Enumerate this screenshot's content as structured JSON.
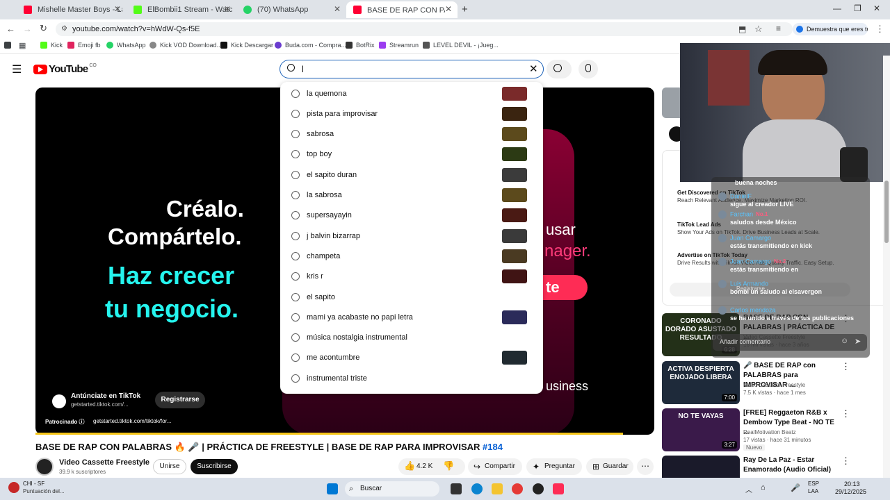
{
  "tabs": [
    {
      "title": "Mishelle Master Boys - La Quem",
      "fav": "#ff0033"
    },
    {
      "title": "ElBombii1 Stream - Watch Live",
      "fav": "#53fc18"
    },
    {
      "title": "(70) WhatsApp",
      "fav": "#25d366"
    },
    {
      "title": "BASE DE RAP CON PALABRAS 🔥",
      "fav": "#ff0033"
    }
  ],
  "address": {
    "url": "youtube.com/watch?v=hWdW-Qs-f5E",
    "profile_text": "Demuestra que eres tú"
  },
  "bookmarks": [
    "Kick",
    "Emoji fb",
    "WhatsApp",
    "Kick VOD Download...",
    "Kick Descargar",
    "Buda.com - Compra...",
    "BotRix",
    "Streamrun",
    "LEVEL DEVIL - ¡Jueg..."
  ],
  "yt": {
    "logo": "YouTube",
    "logo_suffix": "CO",
    "search_value": "l"
  },
  "suggestions": [
    {
      "text": "la quemona",
      "thumb": "#7a2a2a"
    },
    {
      "text": "pista para improvisar",
      "thumb": "#3a2410"
    },
    {
      "text": "sabrosa",
      "thumb": "#5c4a1c"
    },
    {
      "text": "top boy",
      "thumb": "#2c3a14"
    },
    {
      "text": "el sapito duran",
      "thumb": "#3b3b3b"
    },
    {
      "text": "la sabrosa",
      "thumb": "#5c4a1c"
    },
    {
      "text": "supersayayin",
      "thumb": "#4a1a14"
    },
    {
      "text": "j balvin bizarrap",
      "thumb": "#3a3a3a"
    },
    {
      "text": "champeta",
      "thumb": "#4a3a22"
    },
    {
      "text": "kris r",
      "thumb": "#401414"
    },
    {
      "text": "el sapito",
      "thumb": null
    },
    {
      "text": "mami ya acabaste no papi letra",
      "thumb": "#2b2b5a"
    },
    {
      "text": "música nostalgia instrumental",
      "thumb": null
    },
    {
      "text": "me acontumbre",
      "thumb": "#202a30"
    },
    {
      "text": "instrumental triste",
      "thumb": null
    }
  ],
  "ad": {
    "line1": "Créalo.",
    "line2": "Compártelo.",
    "line3": "Haz crecer",
    "line4": "tu negocio.",
    "right_line1": "usar",
    "right_line2": "nager.",
    "right_badge": "te",
    "right_footer": "usiness",
    "advertiser": "Antúnciate en TikTok",
    "advertiser_url": "getstarted.tiktok.com/...",
    "register": "Registrarse",
    "sponsored": "Patrocinado",
    "sponsored_url": "getstarted.tiktok.com/tiktok/for..."
  },
  "video": {
    "title": "BASE DE RAP CON PALABRAS 🔥 🎤 | PRÁCTICA DE FREESTYLE | BASE DE RAP PARA IMPROVISAR",
    "hashtag": "#184",
    "channel": "Video Cassette Freestyle",
    "subs": "39.9 k suscriptores",
    "join": "Unirse",
    "subscribe": "Suscribirse",
    "likes": "4.2 K",
    "share": "Compartir",
    "ask": "Preguntar",
    "save": "Guardar"
  },
  "sidebar_ads": [
    {
      "title": "Get Discovered on TikTok",
      "sub": "Reach Relevant Audience. Maximize Marketing ROI."
    },
    {
      "title": "TikTok Lead Ads",
      "sub": "Show Your Ads on TikTok. Drive Business Leads at Scale."
    },
    {
      "title": "Advertise on TikTok Today",
      "sub": "Drive Results with TikTok Video Ads Quality Traffic. Easy Setup."
    }
  ],
  "recommendations": [
    {
      "title": "BASE DE RAP CON PALABRAS | PRÁCTICA DE ...",
      "channel": "Video Cassette Freestyle",
      "meta": "16 mil vistas · hace 3 años",
      "duration": "6:28",
      "thumb_text": "CORONADO DORADO ASUSTADO RESULTADO",
      "thumb": "#233018"
    },
    {
      "title": "🎤 BASE DE RAP con PALABRAS para IMPROVISAR ...",
      "channel": "Video Cassette Freestyle",
      "meta": "7.5 K vistas · hace 1 mes",
      "duration": "7:00",
      "thumb_text": "ACTIVA DESPIERTA ENOJADO LIBERA",
      "thumb": "#1e2a3a"
    },
    {
      "title": "[FREE] Reggaeton R&B x Dembow Type Beat - NO TE ...",
      "channel": "RealMotivation Beatz",
      "meta": "17 vistas · hace 31 minutos",
      "badge": "Nuevo",
      "duration": "3:27",
      "thumb_text": "NO TE VAYAS",
      "thumb": "#3a1a4a"
    },
    {
      "title": "Ray De La Paz - Estar Enamorado (Audio Oficial)",
      "channel": "",
      "meta": "",
      "duration": "",
      "thumb_text": "",
      "thumb": "#1a1a2a"
    }
  ],
  "chat": {
    "lines": [
      {
        "name": "",
        "text": "buena noches"
      },
      {
        "name": "DanielF",
        "text": "sigue al creador LIVE"
      },
      {
        "name": "Farchan",
        "badge": "No.1",
        "text": "saludos desde México"
      },
      {
        "name": "Juan Camargo",
        "text": "estás transmitiendo en kick"
      },
      {
        "name": "Juan Camargo",
        "badge": "No.2",
        "text": "estás transmitiendo en"
      },
      {
        "name": "Luis Armando",
        "text": "bombi un saludo al elsavergon"
      },
      {
        "name": "Carlos mendoza",
        "text": "se ha unido a través de tus publicaciones"
      }
    ],
    "input_placeholder": "Añadir comentario",
    "overlay_text": "Registrarse"
  },
  "taskbar": {
    "weather": "CHI - SF",
    "weather_sub": "Puntuación del...",
    "search": "Buscar",
    "lang1": "ESP",
    "lang2": "LAA",
    "time": "20:13",
    "date": "29/12/2025"
  }
}
